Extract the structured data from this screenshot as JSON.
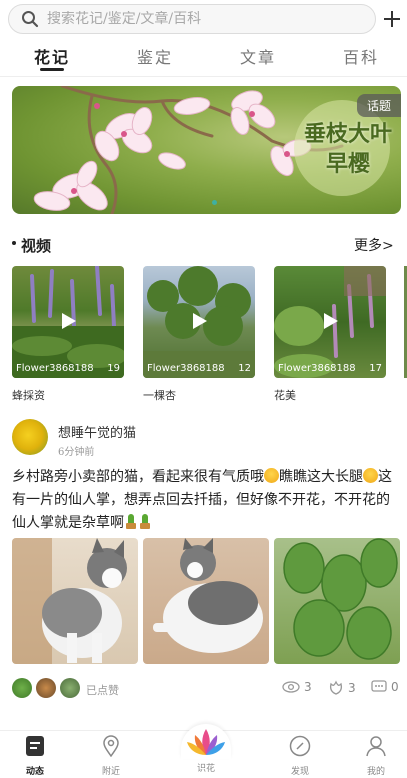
{
  "search": {
    "placeholder": "搜索花记/鉴定/文章/百科"
  },
  "tabs": [
    {
      "label": "花记",
      "active": true
    },
    {
      "label": "鉴定",
      "active": false
    },
    {
      "label": "文章",
      "active": false
    },
    {
      "label": "百科",
      "active": false
    }
  ],
  "banner": {
    "tag": "话题",
    "title_line1": "垂枝大叶",
    "title_line2": "早樱"
  },
  "videos": {
    "title": "视频",
    "more": "更多>",
    "items": [
      {
        "author": "Flower3868188",
        "count": "19",
        "caption": "蜂採资"
      },
      {
        "author": "Flower3868188",
        "count": "12",
        "caption": "一棵杏"
      },
      {
        "author": "Flower3868188",
        "count": "17",
        "caption": "花美"
      }
    ]
  },
  "post": {
    "user": "想睡午觉的猫",
    "time": "6分钟前",
    "text_part1": "乡村路旁小卖部的猫，看起来很有气质哦",
    "text_part2": "瞧瞧这大长腿",
    "text_part3": "这有一片的仙人掌，想弄点回去扦插，但好像不开花，不开花的仙人掌就是杂草啊",
    "liked_label": "已点赞",
    "views": "3",
    "likes": "3",
    "comments": "0"
  },
  "bottom_nav": [
    {
      "label": "动态",
      "icon": "feed-icon",
      "active": true
    },
    {
      "label": "附近",
      "icon": "location-pin-icon",
      "active": false
    },
    {
      "label": "识花",
      "icon": "lotus-icon",
      "active": false
    },
    {
      "label": "发现",
      "icon": "compass-icon",
      "active": false
    },
    {
      "label": "我的",
      "icon": "user-icon",
      "active": false
    }
  ],
  "colors": {
    "accent": "#222222",
    "muted": "#888888",
    "banner_green": "#6f9432"
  }
}
